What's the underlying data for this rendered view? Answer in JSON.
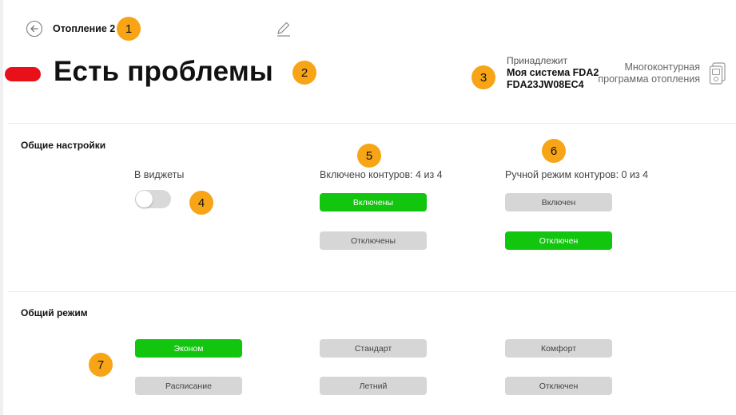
{
  "header": {
    "title": "Отопление 2"
  },
  "status": {
    "text": "Есть проблемы",
    "color": "#e8111a"
  },
  "owner": {
    "label": "Принадлежит",
    "system_name": "Моя система FDA2",
    "system_id": "FDA23JW08EC4"
  },
  "program": {
    "line1": "Многоконтурная",
    "line2": "программа отопления"
  },
  "general_settings": {
    "title": "Общие настройки",
    "widgets_label": "В виджеты",
    "widgets_enabled": false,
    "circuits_label": "Включено контуров: 4 из 4",
    "circuits_on_label": "Включены",
    "circuits_off_label": "Отключены",
    "manual_label": "Ручной режим контуров: 0 из 4",
    "manual_on_label": "Включен",
    "manual_off_label": "Отключен"
  },
  "general_mode": {
    "title": "Общий режим",
    "modes": [
      {
        "label": "Эконом",
        "active": true
      },
      {
        "label": "Стандарт",
        "active": false
      },
      {
        "label": "Комфорт",
        "active": false
      },
      {
        "label": "Расписание",
        "active": false
      },
      {
        "label": "Летний",
        "active": false
      },
      {
        "label": "Отключен",
        "active": false
      }
    ]
  },
  "badges": [
    "1",
    "2",
    "3",
    "4",
    "5",
    "6",
    "7"
  ],
  "colors": {
    "active_green": "#12c50f",
    "inactive_gray": "#d6d6d6",
    "badge_orange": "#f7a416"
  }
}
